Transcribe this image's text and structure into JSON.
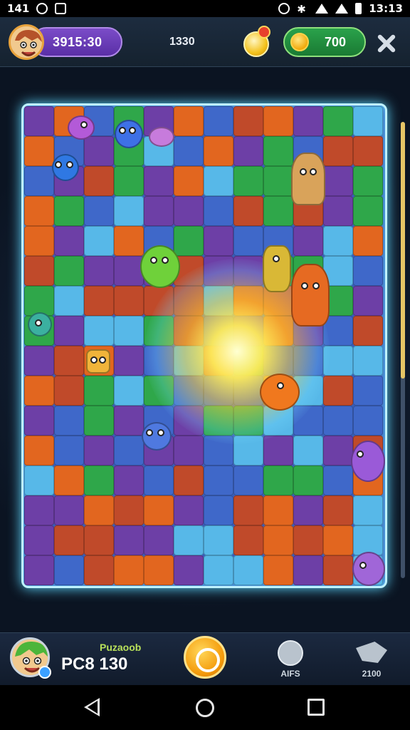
{
  "status_bar": {
    "time_left": "141",
    "time_right": "13:13"
  },
  "top_bar": {
    "player_score": "3915:30",
    "center_value": "1330",
    "coins": "700"
  },
  "bottom_bar": {
    "player_name": "Puzaoob",
    "player_score": "PC8 130",
    "button_left_label": "AIFS",
    "button_right_label": "2100"
  },
  "board": {
    "palette": [
      "#3f68c9",
      "#2fa74a",
      "#6d3fa6",
      "#e2661f",
      "#57b8e8",
      "#c04a2a"
    ]
  },
  "colors": {
    "accent_glow": "#5fd8ff",
    "score_pill": "#6a3cb8",
    "coin_pill": "#22913f"
  }
}
